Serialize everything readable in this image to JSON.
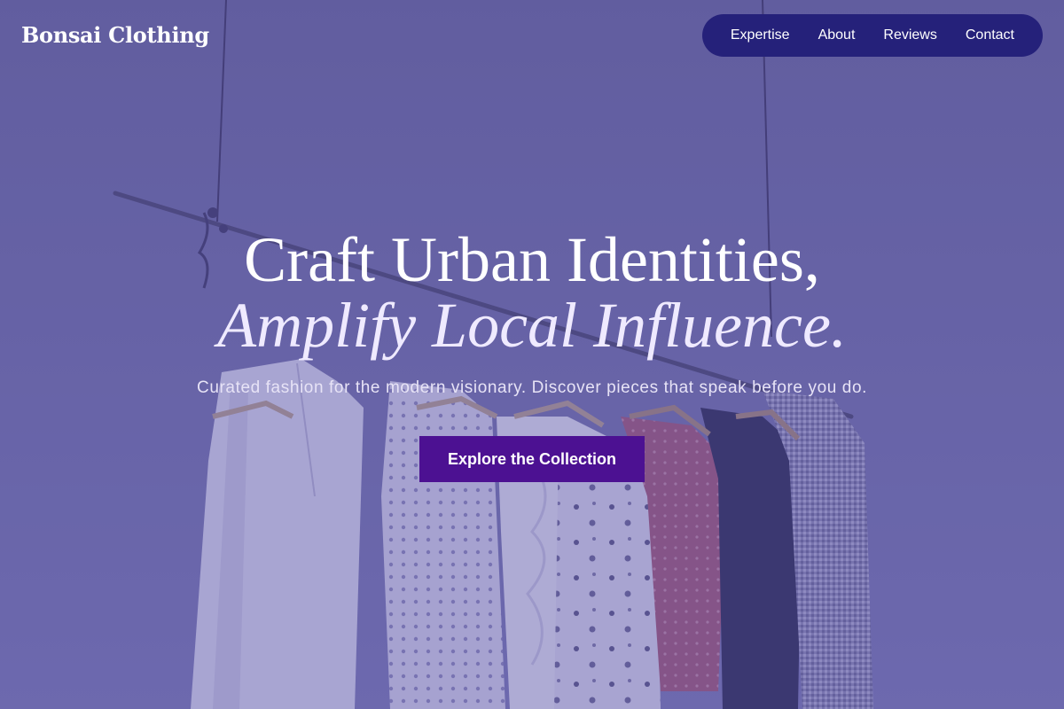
{
  "brand": {
    "name": "Bonsai Clothing"
  },
  "nav": {
    "items": [
      {
        "label": "Expertise"
      },
      {
        "label": "About"
      },
      {
        "label": "Reviews"
      },
      {
        "label": "Contact"
      }
    ]
  },
  "hero": {
    "headline_line1": "Craft Urban Identities,",
    "headline_line2": "Amplify Local Influence.",
    "subtitle": "Curated fashion for the modern visionary. Discover pieces that speak before you do.",
    "cta_label": "Explore the Collection"
  },
  "colors": {
    "nav_background": "#25217a",
    "cta_background": "#4c1192",
    "overlay_tint": "#544ea0"
  }
}
